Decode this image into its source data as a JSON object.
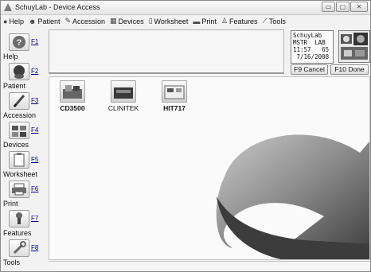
{
  "window": {
    "title": "SchuyLab - Device Access",
    "min_glyph": "▭",
    "max_glyph": "▢",
    "close_glyph": "✕"
  },
  "menu": [
    {
      "label": "Help",
      "icon": "bullet-icon"
    },
    {
      "label": "Patient",
      "icon": "patient-icon"
    },
    {
      "label": "Accession",
      "icon": "pencil-icon"
    },
    {
      "label": "Devices",
      "icon": "devices-icon"
    },
    {
      "label": "Worksheet",
      "icon": "worksheet-icon"
    },
    {
      "label": "Print",
      "icon": "printer-icon"
    },
    {
      "label": "Features",
      "icon": "features-icon"
    },
    {
      "label": "Tools",
      "icon": "wrench-icon"
    }
  ],
  "sidebar": [
    {
      "key": "F1",
      "label": "Help",
      "icon": "help-icon"
    },
    {
      "key": "F2",
      "label": "Patient",
      "icon": "patient-icon"
    },
    {
      "key": "F3",
      "label": "Accession",
      "icon": "pencil-icon"
    },
    {
      "key": "F4",
      "label": "Devices",
      "icon": "devices-icon"
    },
    {
      "key": "F5",
      "label": "Worksheet",
      "icon": "worksheet-icon"
    },
    {
      "key": "F6",
      "label": "Print",
      "icon": "printer-icon"
    },
    {
      "key": "F7",
      "label": "Features",
      "icon": "features-icon"
    },
    {
      "key": "F8",
      "label": "Tools",
      "icon": "wrench-icon"
    }
  ],
  "status_box": {
    "line1": "SchuyLab",
    "line2": "MSTR  LAB",
    "line3": "11:57   65",
    "line4": " 7/16/2008"
  },
  "buttons": {
    "cancel": "F9 Cancel",
    "done": "F10 Done"
  },
  "devices": [
    {
      "label": "CD3500",
      "bold": true
    },
    {
      "label": "CLINITEK",
      "bold": false
    },
    {
      "label": "HIT717",
      "bold": true
    }
  ],
  "colors": {
    "arrow_dark": "#4a4a4a",
    "arrow_light": "#d9d9d9",
    "window_bg": "#f2f2f2"
  }
}
